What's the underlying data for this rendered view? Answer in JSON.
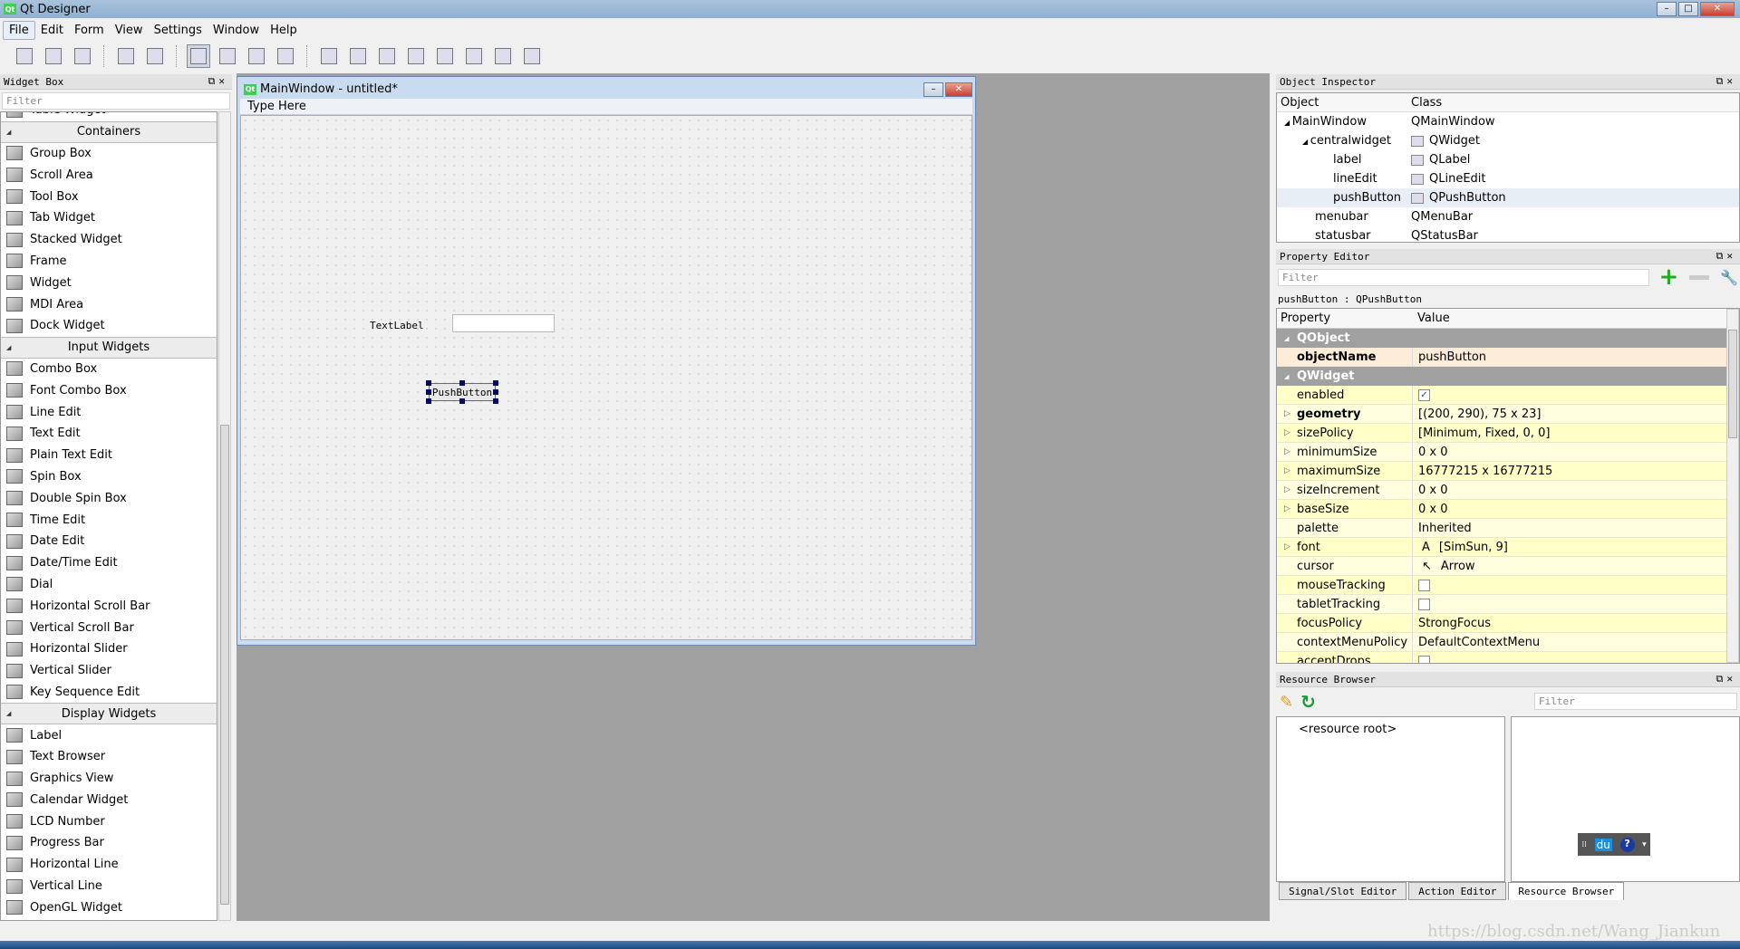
{
  "app": {
    "title": "Qt Designer"
  },
  "menubar": [
    "File",
    "Edit",
    "Form",
    "View",
    "Settings",
    "Window",
    "Help"
  ],
  "toolbar": {
    "groups": [
      [
        "new-file-icon",
        "open-folder-icon",
        "save-icon"
      ],
      [
        "send-to-back-icon",
        "bring-to-front-icon"
      ],
      [
        "edit-widgets-icon",
        "edit-signals-slots-icon",
        "edit-buddies-icon",
        "edit-tab-order-icon"
      ],
      [
        "layout-horizontal-icon",
        "layout-vertical-icon",
        "layout-horizontal-splitter-icon",
        "layout-vertical-splitter-icon",
        "layout-grid-icon",
        "layout-form-icon",
        "break-layout-icon",
        "adjust-size-icon"
      ]
    ]
  },
  "widget_box": {
    "title": "Widget Box",
    "filter_placeholder": "Filter",
    "sections": [
      {
        "category": "",
        "items": [
          "Table Widget"
        ]
      },
      {
        "category": "Containers",
        "items": [
          "Group Box",
          "Scroll Area",
          "Tool Box",
          "Tab Widget",
          "Stacked Widget",
          "Frame",
          "Widget",
          "MDI Area",
          "Dock Widget"
        ]
      },
      {
        "category": "Input Widgets",
        "items": [
          "Combo Box",
          "Font Combo Box",
          "Line Edit",
          "Text Edit",
          "Plain Text Edit",
          "Spin Box",
          "Double Spin Box",
          "Time Edit",
          "Date Edit",
          "Date/Time Edit",
          "Dial",
          "Horizontal Scroll Bar",
          "Vertical Scroll Bar",
          "Horizontal Slider",
          "Vertical Slider",
          "Key Sequence Edit"
        ]
      },
      {
        "category": "Display Widgets",
        "items": [
          "Label",
          "Text Browser",
          "Graphics View",
          "Calendar Widget",
          "LCD Number",
          "Progress Bar",
          "Horizontal Line",
          "Vertical Line",
          "OpenGL Widget"
        ]
      }
    ]
  },
  "form": {
    "title": "MainWindow - untitled*",
    "menu_placeholder": "Type Here",
    "label_text": "TextLabel",
    "button_text": "PushButton"
  },
  "object_inspector": {
    "title": "Object Inspector",
    "columns": [
      "Object",
      "Class"
    ],
    "rows": [
      {
        "object": "MainWindow",
        "class": "QMainWindow",
        "level": 0,
        "expand": true
      },
      {
        "object": "centralwidget",
        "class": "QWidget",
        "level": 1,
        "expand": true
      },
      {
        "object": "label",
        "class": "QLabel",
        "level": 2
      },
      {
        "object": "lineEdit",
        "class": "QLineEdit",
        "level": 2
      },
      {
        "object": "pushButton",
        "class": "QPushButton",
        "level": 2,
        "selected": true
      },
      {
        "object": "menubar",
        "class": "QMenuBar",
        "level": 1
      },
      {
        "object": "statusbar",
        "class": "QStatusBar",
        "level": 1
      }
    ]
  },
  "property_editor": {
    "title": "Property Editor",
    "filter_placeholder": "Filter",
    "context": "pushButton : QPushButton",
    "columns": [
      "Property",
      "Value"
    ],
    "rows": [
      {
        "group": "QObject"
      },
      {
        "name": "objectName",
        "value": "pushButton",
        "bold": true,
        "peach": true
      },
      {
        "group": "QWidget"
      },
      {
        "name": "enabled",
        "check": true
      },
      {
        "name": "geometry",
        "value": "[(200, 290), 75 x 23]",
        "bold": true,
        "exp": true
      },
      {
        "name": "sizePolicy",
        "value": "[Minimum, Fixed, 0, 0]",
        "exp": true
      },
      {
        "name": "minimumSize",
        "value": "0 x 0",
        "exp": true
      },
      {
        "name": "maximumSize",
        "value": "16777215 x 16777215",
        "exp": true
      },
      {
        "name": "sizeIncrement",
        "value": "0 x 0",
        "exp": true
      },
      {
        "name": "baseSize",
        "value": "0 x 0",
        "exp": true
      },
      {
        "name": "palette",
        "value": "Inherited"
      },
      {
        "name": "font",
        "value": "[SimSun, 9]",
        "exp": true,
        "icon": "A"
      },
      {
        "name": "cursor",
        "value": "Arrow",
        "icon": "↖"
      },
      {
        "name": "mouseTracking",
        "check": false
      },
      {
        "name": "tabletTracking",
        "check": false
      },
      {
        "name": "focusPolicy",
        "value": "StrongFocus"
      },
      {
        "name": "contextMenuPolicy",
        "value": "DefaultContextMenu"
      },
      {
        "name": "acceptDrops",
        "check": false
      }
    ]
  },
  "resource_browser": {
    "title": "Resource Browser",
    "filter_placeholder": "Filter",
    "root": "<resource root>"
  },
  "bottom_tabs": [
    "Signal/Slot Editor",
    "Action Editor",
    "Resource Browser"
  ],
  "ime_toolbar": {
    "label": "du",
    "help": "?"
  },
  "watermark": "https://blog.csdn.net/Wang_Jiankun",
  "colors": {
    "property_bg": "#ffffe0",
    "group_bg": "#a0a0a0",
    "mdi_bg": "#a0a0a0"
  }
}
